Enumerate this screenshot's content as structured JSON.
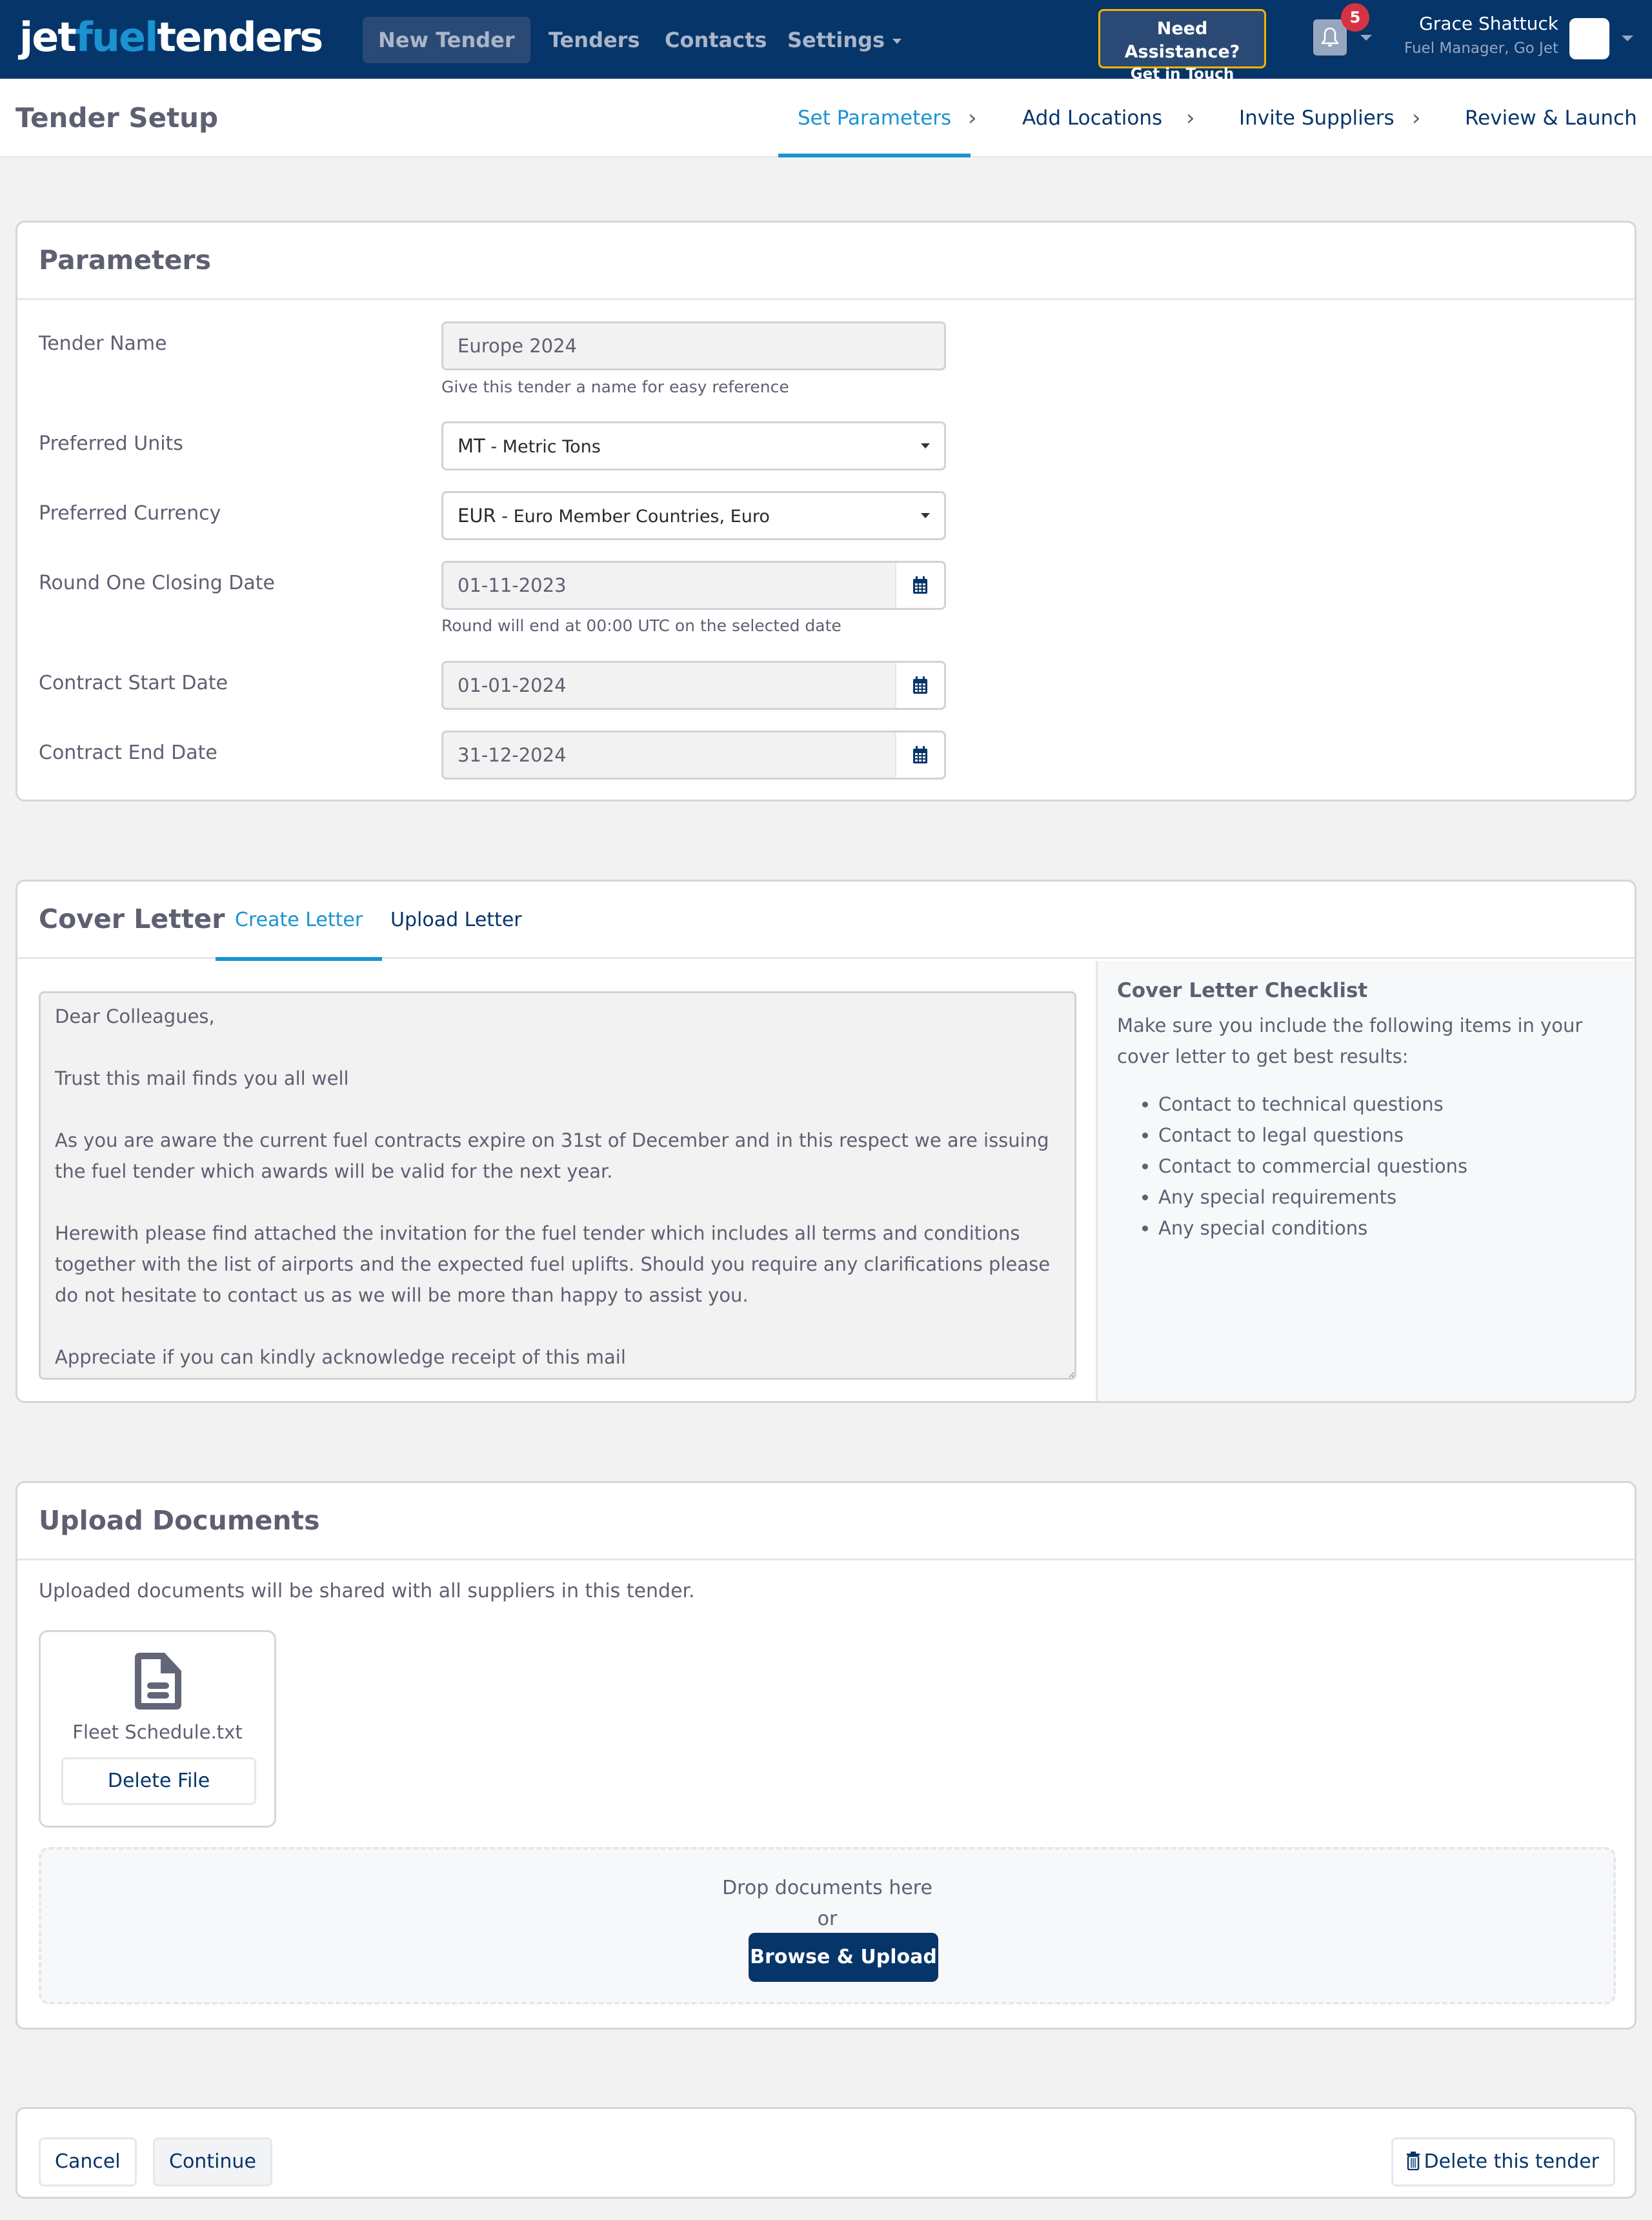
{
  "app": {
    "logo": {
      "part1": "jet",
      "part2": "fuel",
      "part3": "tenders"
    },
    "nav": [
      {
        "label": "New Tender",
        "active": true
      },
      {
        "label": "Tenders"
      },
      {
        "label": "Contacts"
      },
      {
        "label": "Settings",
        "has_dropdown": true
      }
    ],
    "assistance": {
      "line1": "Need Assistance?",
      "line2": "Get in Touch"
    },
    "notifications": {
      "count": "5",
      "icon": "bell-icon"
    },
    "user": {
      "name": "Grace Shattuck",
      "role": "Fuel Manager, Go Jet"
    },
    "colors": {
      "brand_navy": "#06356a",
      "accent_blue": "#1a93d0",
      "badge_red": "#d63342",
      "assist_border": "#f0b400"
    }
  },
  "page": {
    "title": "Tender Setup",
    "steps": [
      {
        "label": "Set Parameters",
        "active": true
      },
      {
        "label": "Add Locations"
      },
      {
        "label": "Invite Suppliers"
      },
      {
        "label": "Review & Launch"
      }
    ]
  },
  "parameters": {
    "title": "Parameters",
    "tender_name": {
      "label": "Tender Name",
      "value": "Europe 2024",
      "help": "Give this tender a name for easy reference"
    },
    "units": {
      "label": "Preferred Units",
      "code": "MT",
      "text": " - Metric Tons"
    },
    "currency": {
      "label": "Preferred Currency",
      "code": "EUR",
      "text": " - Euro Member Countries, Euro"
    },
    "round_close": {
      "label": "Round One Closing Date",
      "value": "01-11-2023",
      "help": "Round will end at 00:00 UTC on the selected date"
    },
    "contract_start": {
      "label": "Contract Start Date",
      "value": "01-01-2024"
    },
    "contract_end": {
      "label": "Contract End Date",
      "value": "31-12-2024"
    }
  },
  "cover_letter": {
    "title": "Cover Letter",
    "tabs": [
      {
        "label": "Create Letter",
        "active": true
      },
      {
        "label": "Upload Letter"
      }
    ],
    "body": "Dear Colleagues,\n\nTrust this mail finds you all well\n\nAs you are aware the current fuel contracts expire on 31st of December and in this respect we are issuing the fuel tender which awards will be valid for the next year.\n\nHerewith please find attached the invitation for the fuel tender which includes all terms and conditions together with the list of airports and the expected fuel uplifts. Should you require any clarifications please do not hesitate to contact us as we will be more than happy to assist you.\n\nAppreciate if you can kindly acknowledge receipt of this mail",
    "checklist": {
      "title": "Cover Letter Checklist",
      "intro": "Make sure you include the following items in your cover letter to get best results:",
      "items": [
        "Contact to technical questions",
        "Contact to legal questions",
        "Contact to commercial questions",
        "Any special requirements",
        "Any special conditions"
      ]
    }
  },
  "upload": {
    "title": "Upload Documents",
    "note": "Uploaded documents will be shared with all suppliers in this tender.",
    "files": [
      {
        "name": "Fleet Schedule.txt",
        "delete_label": "Delete File",
        "icon": "file-text-icon"
      }
    ],
    "drop_text": "Drop documents here",
    "or_text": "or",
    "browse_label": "Browse & Upload"
  },
  "footer": {
    "cancel_label": "Cancel",
    "continue_label": "Continue",
    "delete_label": "Delete this tender"
  }
}
